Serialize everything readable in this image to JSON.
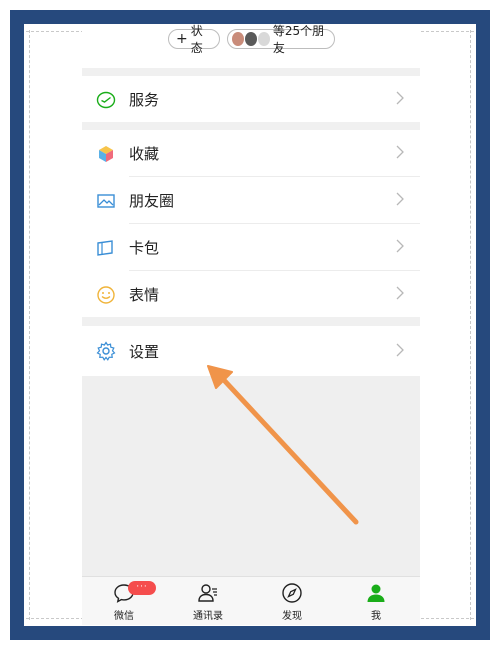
{
  "header": {
    "status_chip": "状态",
    "friends_chip": "等25个朋友"
  },
  "menu": {
    "items": [
      {
        "label": "服务",
        "icon": "service-icon"
      },
      {
        "label": "收藏",
        "icon": "favorites-cube-icon"
      },
      {
        "label": "朋友圈",
        "icon": "moments-image-icon"
      },
      {
        "label": "卡包",
        "icon": "card-wallet-icon"
      },
      {
        "label": "表情",
        "icon": "emoji-smile-icon"
      },
      {
        "label": "设置",
        "icon": "gear-icon"
      }
    ]
  },
  "tabbar": {
    "tabs": [
      {
        "label": "微信",
        "badge": "···"
      },
      {
        "label": "通讯录"
      },
      {
        "label": "发现"
      },
      {
        "label": "我"
      }
    ]
  },
  "colors": {
    "frame": "#26497d",
    "arrow": "#f0944a",
    "accent_green": "#1aad19",
    "badge_red": "#f54d4d"
  }
}
